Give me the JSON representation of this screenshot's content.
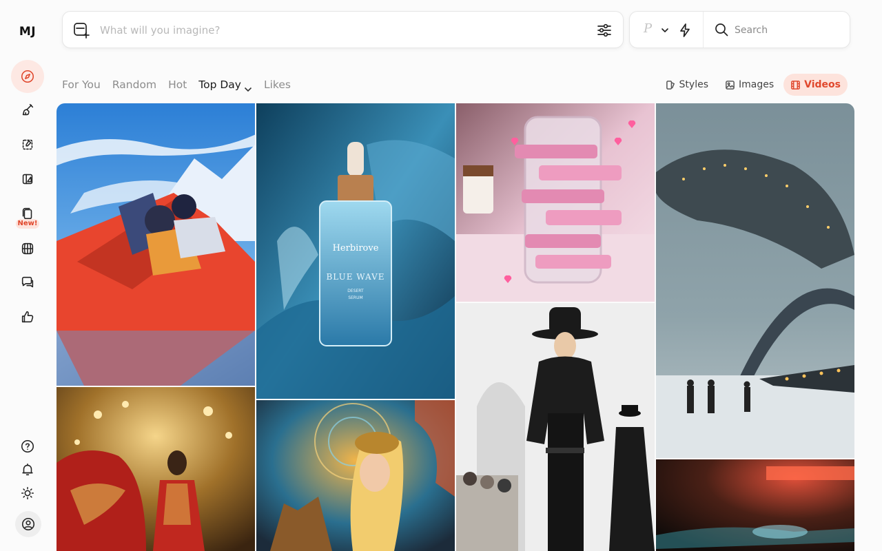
{
  "brand": {
    "logo": "MJ"
  },
  "sidebar": {
    "items": [
      {
        "name": "explore",
        "icon": "compass-icon",
        "active": true
      },
      {
        "name": "create",
        "icon": "paintbrush-icon"
      },
      {
        "name": "edit",
        "icon": "edit-icon"
      },
      {
        "name": "organize",
        "icon": "organize-icon"
      },
      {
        "name": "personalize",
        "icon": "copy-icon",
        "badge": "New!"
      },
      {
        "name": "rooms",
        "icon": "globe-icon"
      },
      {
        "name": "chat",
        "icon": "chat-bubbles-icon"
      },
      {
        "name": "likes",
        "icon": "thumbs-up-icon"
      }
    ],
    "bottom": [
      "help-icon",
      "bell-icon",
      "sun-icon",
      "user-icon"
    ]
  },
  "prompt": {
    "placeholder": "What will you imagine?"
  },
  "controls": {
    "p_label": "P"
  },
  "search": {
    "placeholder": "Search"
  },
  "tabs": {
    "for_you": "For You",
    "random": "Random",
    "hot": "Hot",
    "top_day": "Top Day",
    "likes": "Likes"
  },
  "right_tabs": {
    "styles": "Styles",
    "images": "Images",
    "videos": "Videos"
  },
  "colors": {
    "accent": "#e0472c",
    "accent_bg": "#fde3dc"
  },
  "gallery": {
    "items": [
      {
        "id": "anime-red-car",
        "label": ""
      },
      {
        "id": "serum-bottle",
        "brand": "Herbirove",
        "title": "BLUE WAVE",
        "line1": "DESERT",
        "line2": "SERUM"
      },
      {
        "id": "pink-phone-hearts"
      },
      {
        "id": "airship-fog-bridge"
      },
      {
        "id": "gold-chandelier-fashion"
      },
      {
        "id": "golden-mosaic-portrait"
      },
      {
        "id": "runway-black-outfit"
      },
      {
        "id": "neon-motion-blur"
      }
    ]
  }
}
